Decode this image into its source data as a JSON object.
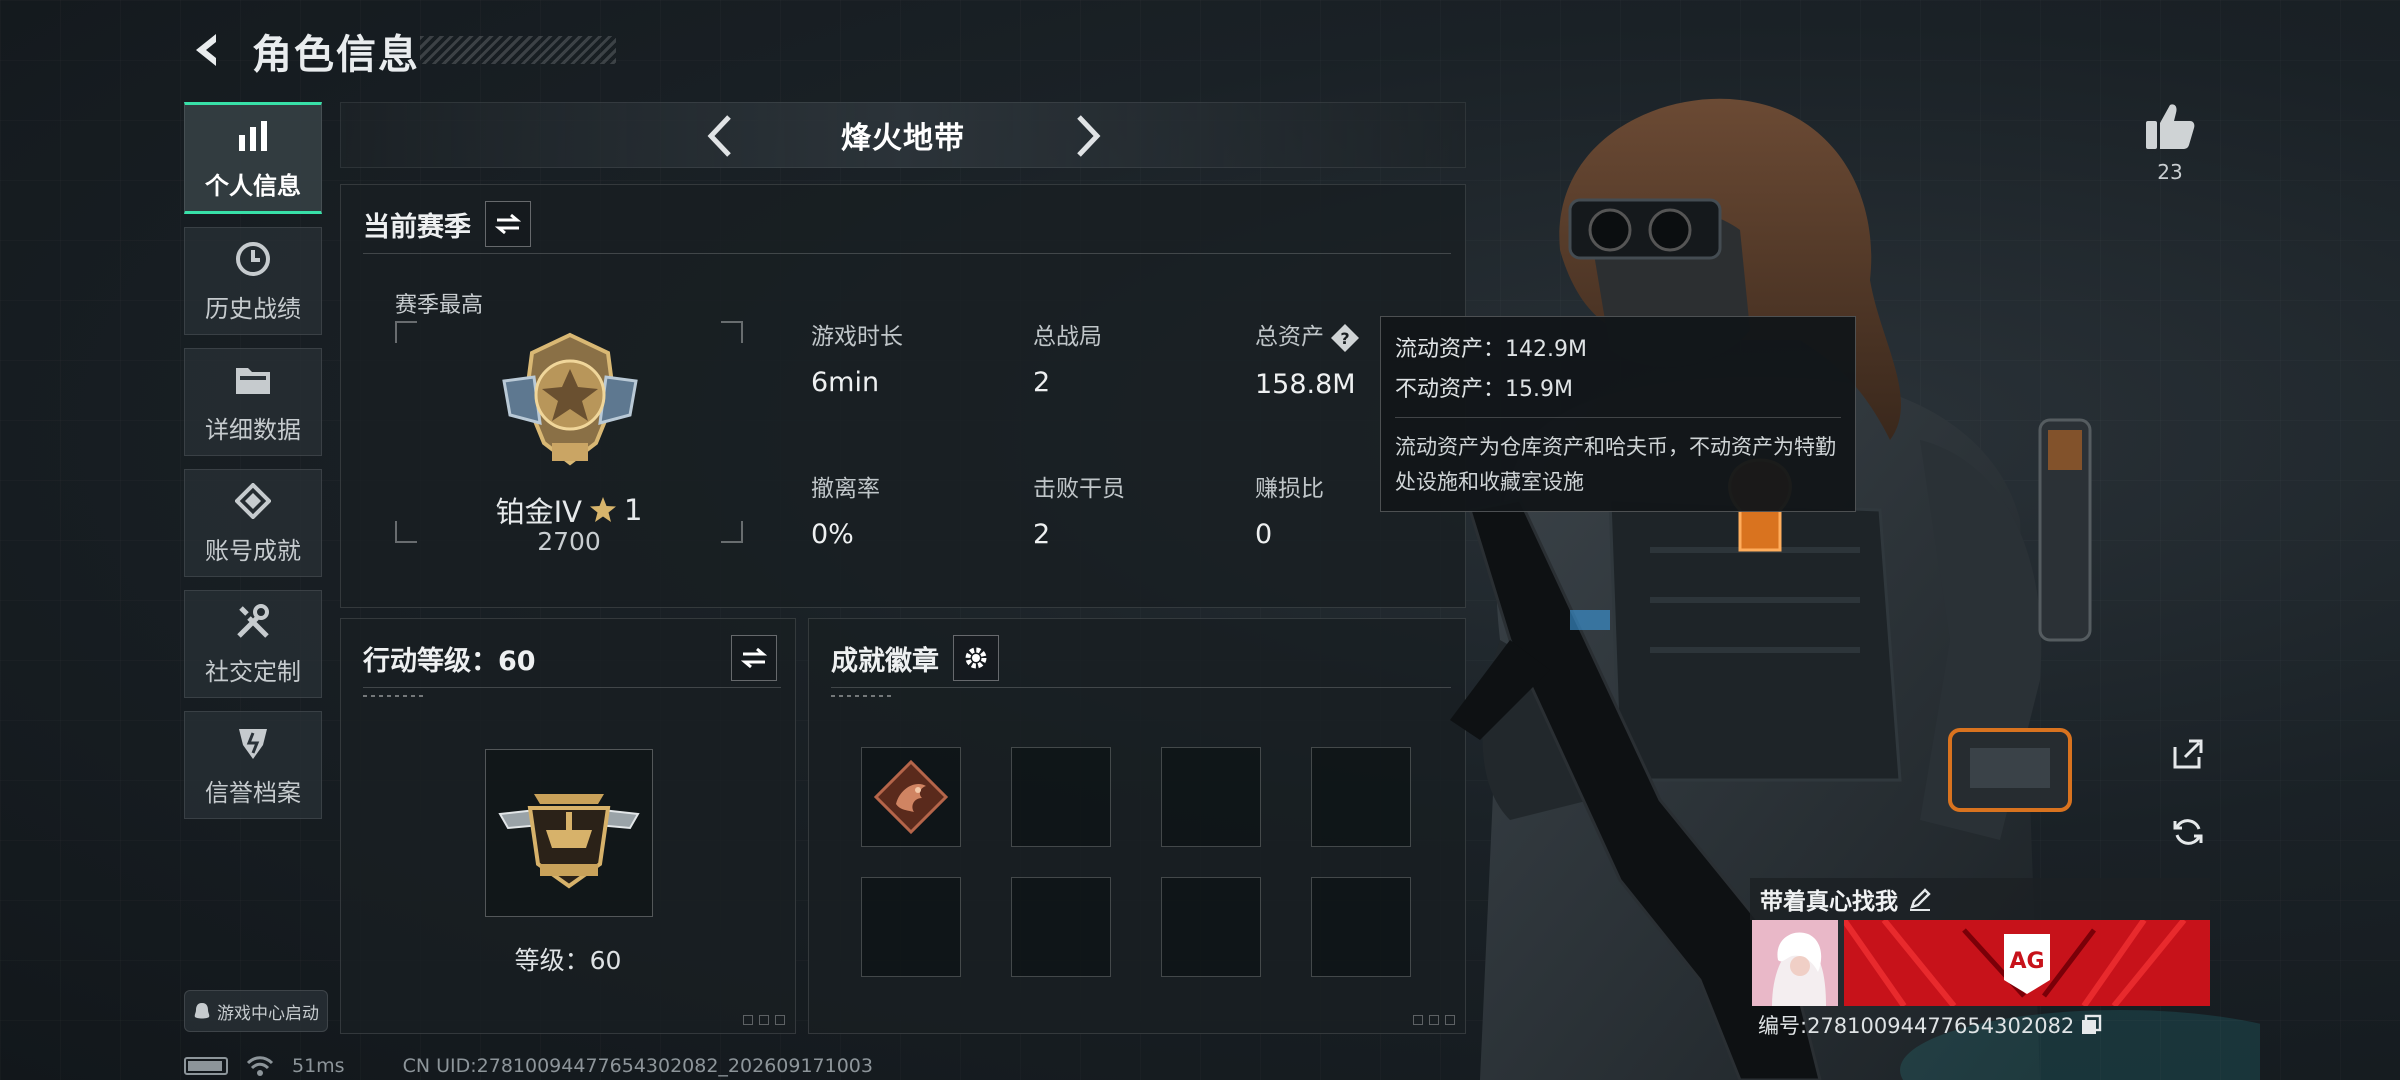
{
  "page": {
    "title": "角色信息"
  },
  "nav": {
    "items": [
      {
        "label": "个人信息",
        "icon": "bar-chart-icon",
        "active": true
      },
      {
        "label": "历史战绩",
        "icon": "clock-icon",
        "active": false
      },
      {
        "label": "详细数据",
        "icon": "folder-icon",
        "active": false
      },
      {
        "label": "账号成就",
        "icon": "achievement-icon",
        "active": false
      },
      {
        "label": "社交定制",
        "icon": "tools-icon",
        "active": false
      },
      {
        "label": "信誉档案",
        "icon": "shield-icon",
        "active": false
      }
    ],
    "game_center_label": "游戏中心启动"
  },
  "mode": {
    "title": "烽火地带"
  },
  "season": {
    "title": "当前赛季",
    "best_label": "赛季最高",
    "rank_name": "铂金IV",
    "rank_stars": "1",
    "rank_points": "2700",
    "stats": [
      {
        "label": "游戏时长",
        "value": "6min"
      },
      {
        "label": "总战局",
        "value": "2"
      },
      {
        "label": "总资产",
        "value": "158.8M",
        "has_help": true
      },
      {
        "label": "撤离率",
        "value": "0%"
      },
      {
        "label": "击败干员",
        "value": "2"
      },
      {
        "label": "赚损比",
        "value": "0"
      }
    ]
  },
  "tooltip": {
    "liquid_label": "流动资产：",
    "liquid_value": "142.9M",
    "fixed_label": "不动资产：",
    "fixed_value": "15.9M",
    "description": "流动资产为仓库资产和哈夫币，不动资产为特勤处设施和收藏室设施"
  },
  "action_level": {
    "title": "行动等级：60",
    "level_text": "等级：60"
  },
  "badges": {
    "title": "成就徽章",
    "slots": [
      {
        "filled": true,
        "icon": "dragon-badge-icon"
      },
      {
        "filled": false
      },
      {
        "filled": false
      },
      {
        "filled": false
      },
      {
        "filled": false
      },
      {
        "filled": false
      },
      {
        "filled": false
      },
      {
        "filled": false
      }
    ]
  },
  "like": {
    "count": "23"
  },
  "card": {
    "name": "带着真心找我",
    "id_label": "编号:27810094477654302082",
    "banner_text": "AG"
  },
  "status_bar": {
    "ping": "51ms",
    "uid": "CN UID:27810094477654302082_202609171003"
  },
  "colors": {
    "accent": "#38e0a8",
    "banner_red": "#d8141c",
    "gold": "#c9a25a"
  }
}
